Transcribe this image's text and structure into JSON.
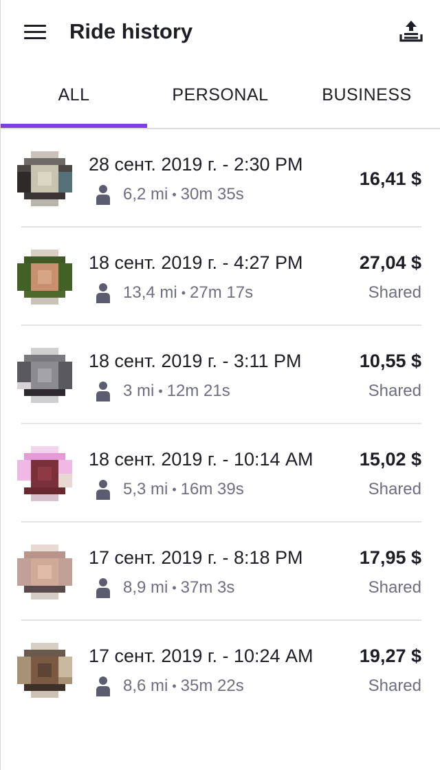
{
  "header": {
    "title": "Ride history",
    "menu_icon": "hamburger-menu-icon",
    "export_icon": "upload-tray-icon"
  },
  "tabs": [
    {
      "label": "ALL",
      "selected": true
    },
    {
      "label": "PERSONAL",
      "selected": false
    },
    {
      "label": "BUSINESS",
      "selected": false
    }
  ],
  "accent_color": "#7b3fe4",
  "rides": [
    {
      "datetime": "28 сент. 2019 г. - 2:30 PM",
      "distance": "6,2 mi",
      "duration": "30m 35s",
      "price": "16,41 $",
      "tag": ""
    },
    {
      "datetime": "18 сент. 2019 г. - 4:27 PM",
      "distance": "13,4 mi",
      "duration": "27m 17s",
      "price": "27,04 $",
      "tag": "Shared"
    },
    {
      "datetime": "18 сент. 2019 г. - 3:11 PM",
      "distance": "3 mi",
      "duration": "12m 21s",
      "price": "10,55 $",
      "tag": "Shared"
    },
    {
      "datetime": "18 сент. 2019 г. - 10:14 AM",
      "distance": "5,3 mi",
      "duration": "16m 39s",
      "price": "15,02 $",
      "tag": "Shared"
    },
    {
      "datetime": "17 сент. 2019 г. - 8:18 PM",
      "distance": "8,9 mi",
      "duration": "37m 3s",
      "price": "17,95 $",
      "tag": "Shared"
    },
    {
      "datetime": "17 сент. 2019 г. - 10:24 AM",
      "distance": "8,6 mi",
      "duration": "35m 22s",
      "price": "19,27 $",
      "tag": "Shared"
    }
  ]
}
